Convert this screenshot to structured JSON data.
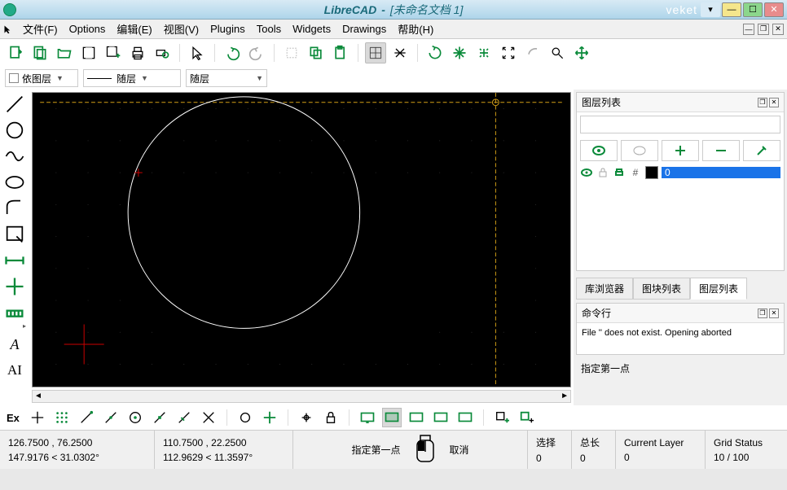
{
  "titlebar": {
    "app": "LibreCAD",
    "doc": "[未命名文档 1]",
    "right": "veket"
  },
  "menubar": {
    "file": "文件(F)",
    "options": "Options",
    "edit": "编辑(E)",
    "view": "视图(V)",
    "plugins": "Plugins",
    "tools": "Tools",
    "widgets": "Widgets",
    "drawings": "Drawings",
    "help": "帮助(H)"
  },
  "stylebar": {
    "layer": "依图层",
    "linetype": "随层",
    "lineweight": "随层"
  },
  "panels": {
    "layers_title": "图层列表",
    "cmd_title": "命令行",
    "layer_zero": "0",
    "tab_lib": "库浏览器",
    "tab_blocks": "图块列表",
    "tab_layers": "图层列表",
    "cmd_body": "File '' does not exist. Opening aborted",
    "cmd_prompt": "指定第一点"
  },
  "status": {
    "abs_coord": "126.7500 , 76.2500",
    "polar_coord": "147.9176 < 31.0302°",
    "rel_coord": "110.7500 , 22.2500",
    "rel_polar": "112.9629 < 11.3597°",
    "prompt": "指定第一点",
    "cancel": "取消",
    "sel_label": "选择",
    "sel_val": "0",
    "len_label": "总长",
    "len_val": "0",
    "layer_label": "Current Layer",
    "layer_val": "0",
    "grid_label": "Grid Status",
    "grid_val": "10 / 100"
  },
  "snapbar": {
    "ex": "Ex"
  }
}
